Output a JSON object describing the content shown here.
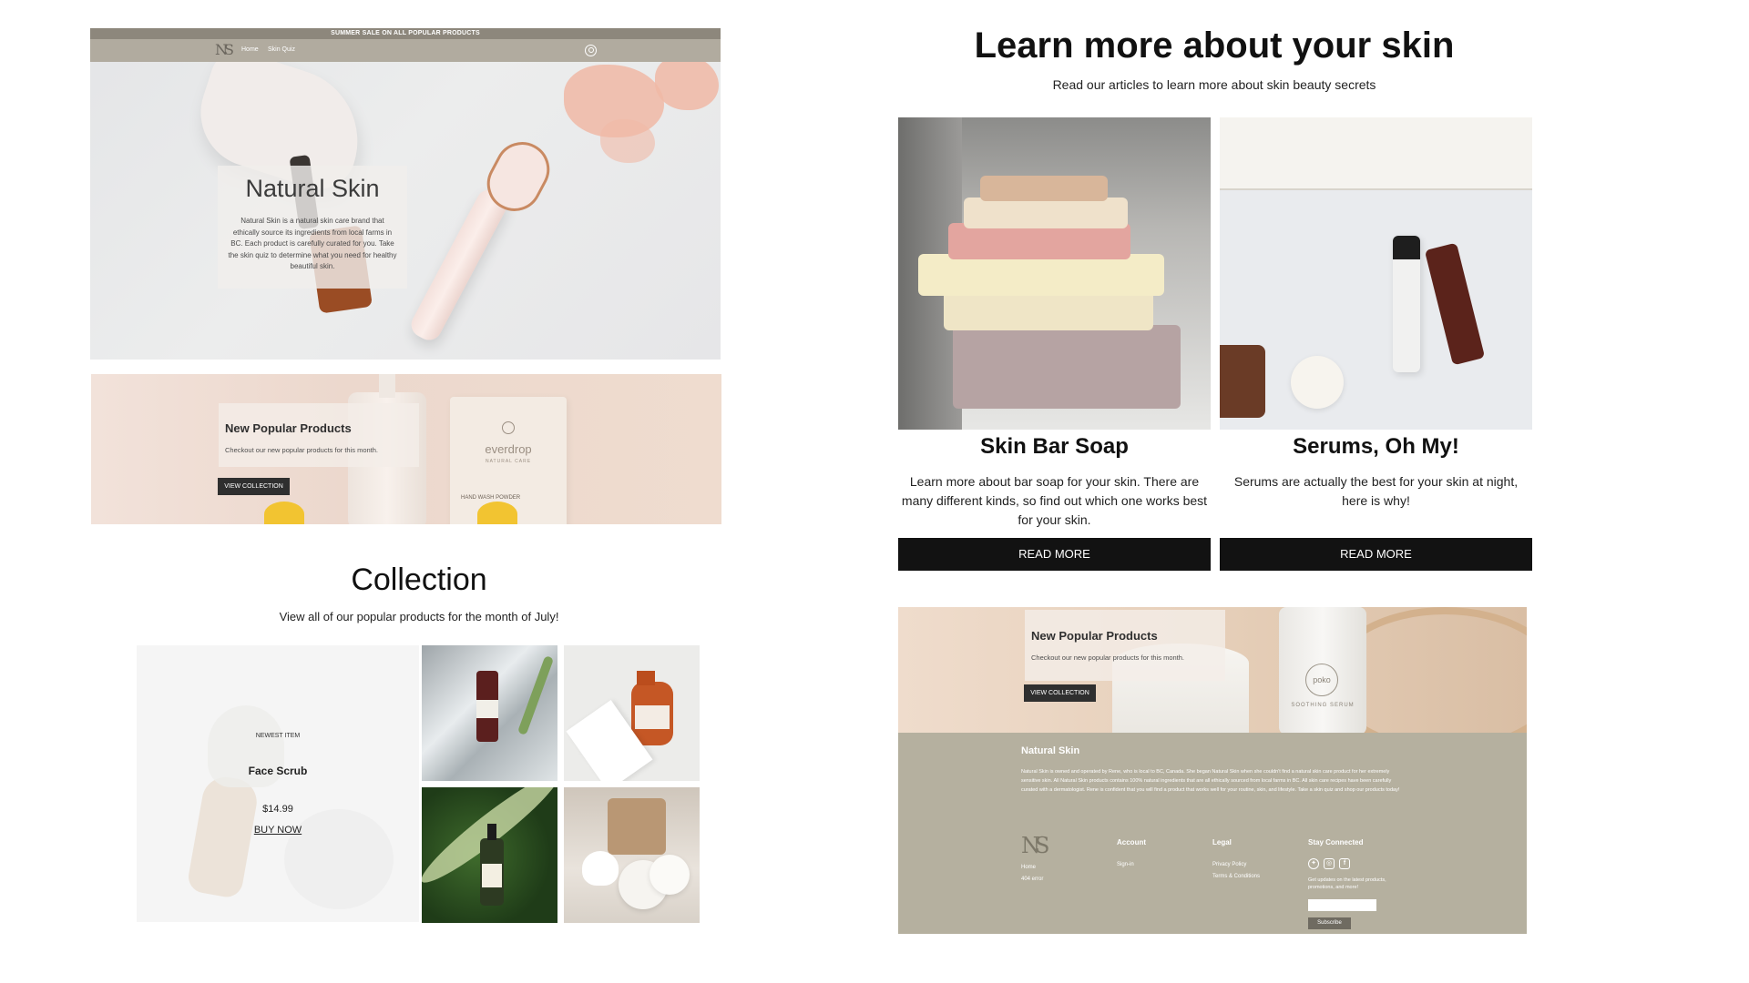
{
  "hero": {
    "promo": "SUMMER SALE ON ALL POPULAR PRODUCTS",
    "logo": "NS",
    "nav": [
      "Home",
      "Skin Quiz"
    ],
    "title": "Natural Skin",
    "text": "Natural Skin is a natural skin care brand that ethically source its ingredients from local farms in BC. Each product is carefully curated for you. Take the skin quiz to determine what you need for healthy beautiful skin."
  },
  "popular1": {
    "title": "New Popular Products",
    "text": "Checkout our new popular products for this month.",
    "button": "VIEW COLLECTION",
    "pouch_brand": "everdrop",
    "pouch_sub": "NATURAL CARE",
    "pouch_label": "HAND WASH POWDER"
  },
  "collection": {
    "title": "Collection",
    "subtitle": "View all of our popular products for the month of July!",
    "feature": {
      "badge": "NEWEST ITEM",
      "name": "Face Scrub",
      "price": "$14.99",
      "cta": "BUY NOW"
    }
  },
  "articles": {
    "title": "Learn more about your skin",
    "subtitle": "Read our articles to learn more about skin beauty secrets",
    "items": [
      {
        "title": "Skin Bar Soap",
        "text": "Learn more about bar soap for your skin. There are many different kinds, so find out which one works best for your skin.",
        "button": "READ MORE"
      },
      {
        "title": "Serums, Oh My!",
        "text": "Serums are actually the best for your skin at night, here is why!",
        "button": "READ MORE"
      }
    ]
  },
  "popular2": {
    "title": "New Popular Products",
    "text": "Checkout our new popular products for this month.",
    "button": "VIEW COLLECTION",
    "tube_brand": "poko",
    "tube_sub": "SOOTHING SERUM"
  },
  "footer": {
    "title": "Natural Skin",
    "about": "Natural Skin is owned and operated by Rene, who is local to BC, Canada. She began Natural Skin when she couldn't find a natural skin care product for her extremely sensitive skin. All Natural Skin products contains 100% natural ingredients that are all ethically sourced from local farms in BC. All skin care recipes have been carefully curated with a dermatologist. Rene is confident that you will find a product that works well for your routine, skin, and lifestyle. Take a skin quiz and shop our products today!",
    "logo": "NS",
    "home_links": [
      "Home",
      "404 error"
    ],
    "account": {
      "heading": "Account",
      "links": [
        "Sign-in"
      ]
    },
    "legal": {
      "heading": "Legal",
      "links": [
        "Privacy Policy",
        "Terms & Conditions"
      ]
    },
    "connect": {
      "heading": "Stay Connected",
      "text": "Get updates on the latest products, promotions, and more!",
      "button": "Subscribe"
    },
    "social_icons": [
      "twitter-icon",
      "instagram-icon",
      "facebook-icon"
    ]
  },
  "colors": {
    "nav_bar": "#b1ab9f",
    "promo_bar": "#8d877c",
    "footer": "#b5b09f",
    "button_dark": "#121212"
  }
}
